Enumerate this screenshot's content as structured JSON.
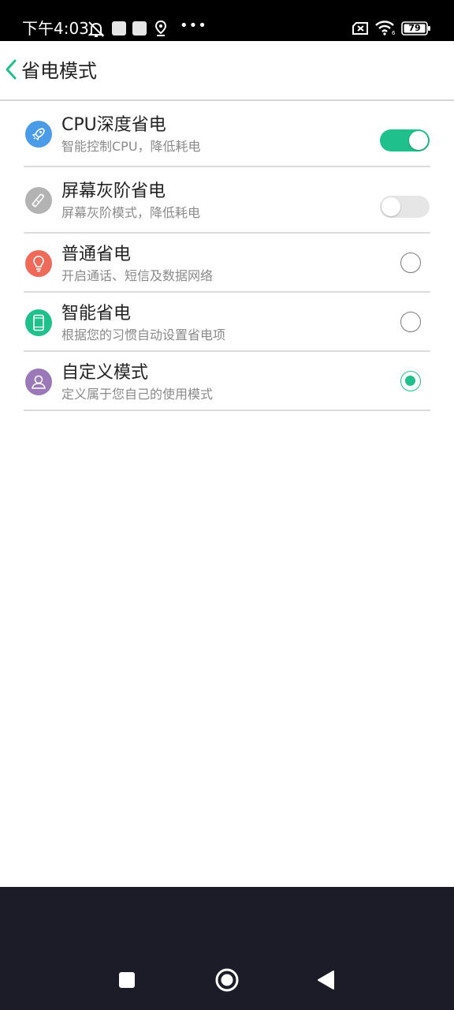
{
  "status_bar": {
    "time": "下午4:03",
    "dots": "•••",
    "battery": "79",
    "icons": [
      "mute-bell-icon",
      "notification-square-icon",
      "notification-square-icon",
      "location-icon",
      "no-sim-icon",
      "wifi-icon",
      "battery-icon"
    ]
  },
  "header": {
    "title": "省电模式",
    "back_icon": "chevron-left-icon"
  },
  "items": [
    {
      "title": "CPU深度省电",
      "subtitle": "智能控制CPU，降低耗电",
      "icon": "rocket-icon",
      "icon_color": "#4a9be8",
      "control": "toggle",
      "state": "on"
    },
    {
      "title": "屏幕灰阶省电",
      "subtitle": "屏幕灰阶模式，降低耗电",
      "icon": "magic-wand-icon",
      "icon_color": "#b3b3b3",
      "control": "toggle",
      "state": "off"
    },
    {
      "title": "普通省电",
      "subtitle": "开启通话、短信及数据网络",
      "icon": "lightbulb-icon",
      "icon_color": "#f06a5a",
      "control": "radio",
      "state": "unselected"
    },
    {
      "title": "智能省电",
      "subtitle": "根据您的习惯自动设置省电项",
      "icon": "phone-icon",
      "icon_color": "#1fc08c",
      "control": "radio",
      "state": "unselected"
    },
    {
      "title": "自定义模式",
      "subtitle": "定义属于您自己的使用模式",
      "icon": "user-icon",
      "icon_color": "#9b78b8",
      "control": "radio",
      "state": "selected"
    }
  ],
  "colors": {
    "accent": "#1fc08c",
    "navbar": "#1c1c28"
  },
  "nav": [
    "recents-square-icon",
    "home-circle-icon",
    "back-triangle-icon"
  ]
}
